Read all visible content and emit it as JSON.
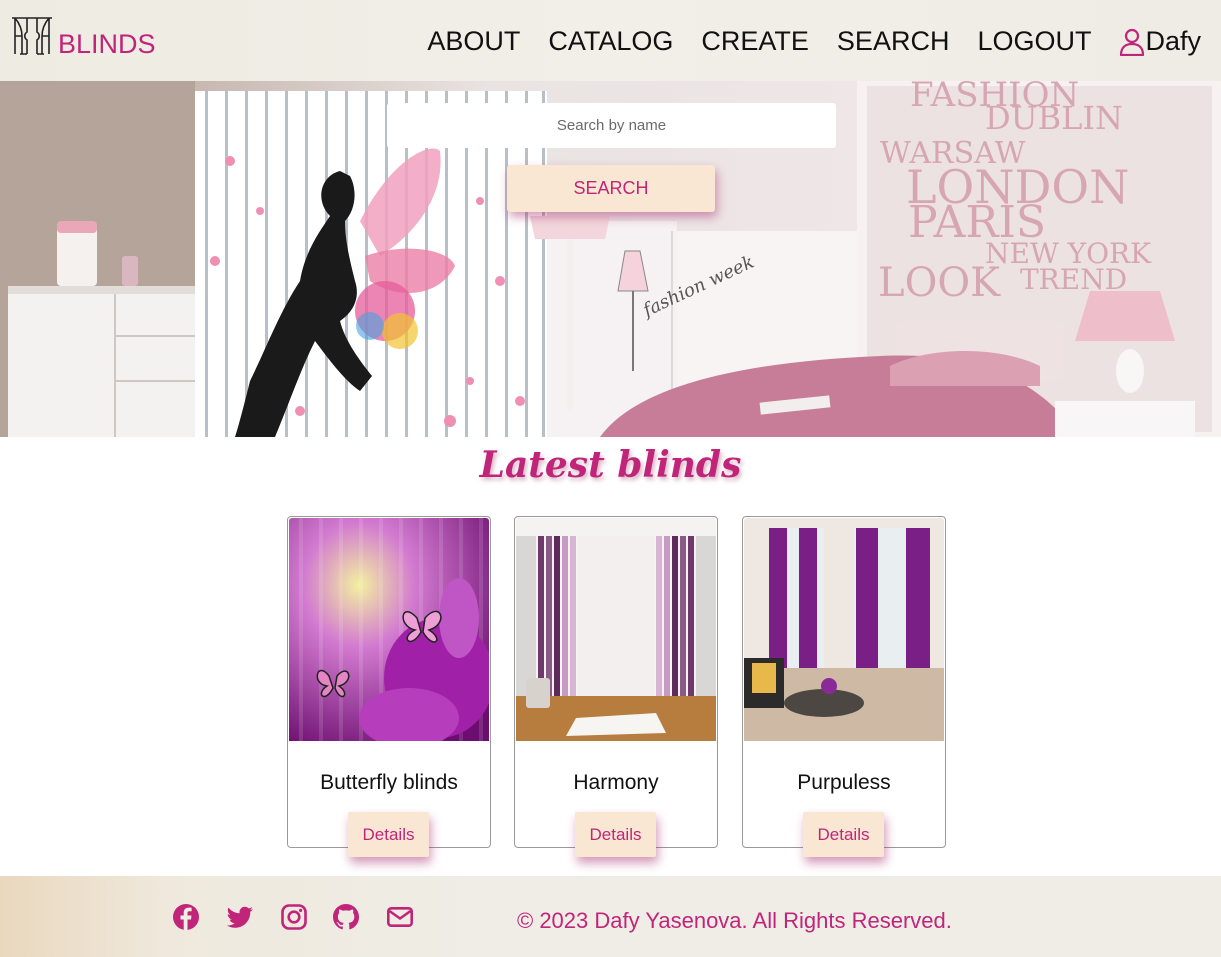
{
  "brand": {
    "logo_text": "BLINDS",
    "accent_color": "#c0257a"
  },
  "nav": {
    "links": [
      "ABOUT",
      "CATALOG",
      "CREATE",
      "SEARCH",
      "LOGOUT"
    ],
    "user_name": "Dafy",
    "user_icon": "user-icon"
  },
  "hero": {
    "search_placeholder": "Search by name",
    "search_value": "",
    "search_button": "SEARCH",
    "wall_words": [
      "FASHION",
      "DUBLIN",
      "WARSAW",
      "LONDON",
      "PARIS",
      "NEW YORK",
      "LOOK",
      "TREND"
    ],
    "wardrobe_script": "fashion week"
  },
  "main": {
    "title": "Latest blinds",
    "cards": [
      {
        "title": "Butterfly blinds",
        "button": "Details"
      },
      {
        "title": "Harmony",
        "button": "Details"
      },
      {
        "title": "Purpuless",
        "button": "Details"
      }
    ]
  },
  "footer": {
    "icons": [
      "facebook-icon",
      "twitter-icon",
      "instagram-icon",
      "github-icon",
      "mail-icon"
    ],
    "copyright": "© 2023 Dafy Yasenova. All Rights Reserved."
  }
}
